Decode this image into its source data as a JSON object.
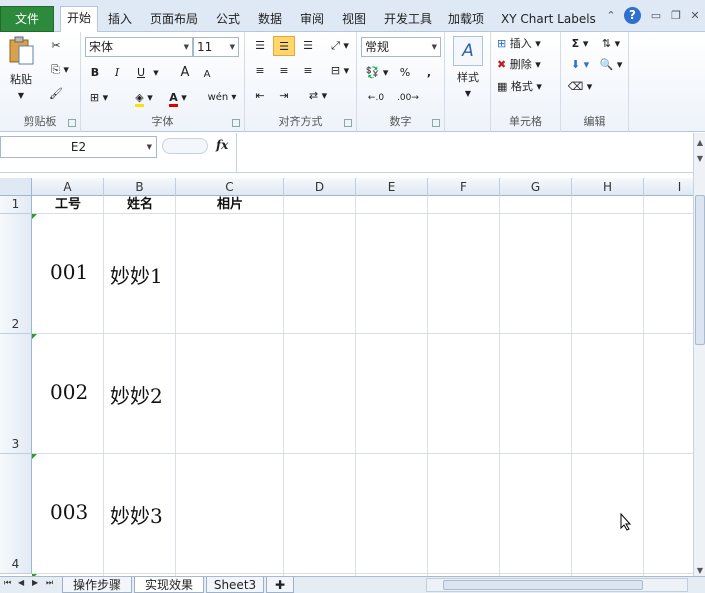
{
  "tabs": {
    "file": "文件",
    "items": [
      "开始",
      "插入",
      "页面布局",
      "公式",
      "数据",
      "审阅",
      "视图",
      "开发工具",
      "加载项",
      "XY Chart Labels"
    ],
    "active": "开始"
  },
  "ribbon": {
    "clipboard": {
      "label": "剪贴板",
      "paste": "粘贴"
    },
    "font": {
      "label": "字体",
      "name": "宋体",
      "size": "11",
      "bold": "B",
      "italic": "I",
      "underline": "U",
      "grow": "A",
      "shrink": "A",
      "phonetic": "wén"
    },
    "alignment": {
      "label": "对齐方式"
    },
    "number": {
      "label": "数字",
      "format": "常规",
      "percent": "%",
      "comma": ",",
      "inc_decimal": ".0",
      "dec_decimal": ".00"
    },
    "styles": {
      "label": "样式"
    },
    "cells": {
      "label": "单元格",
      "insert": "插入",
      "delete": "删除",
      "format": "格式"
    },
    "editing": {
      "label": "编辑",
      "sum": "Σ"
    }
  },
  "formula_bar": {
    "name_box": "E2",
    "fx": "fx",
    "value": ""
  },
  "grid": {
    "columns": [
      "A",
      "B",
      "C",
      "D",
      "E",
      "F",
      "G",
      "H",
      "I"
    ],
    "rows": [
      "1",
      "2",
      "3",
      "4"
    ],
    "header_cells": {
      "A1": "工号",
      "B1": "姓名",
      "C1": "相片"
    },
    "data": [
      {
        "id": "001",
        "name": "妙妙1"
      },
      {
        "id": "002",
        "name": "妙妙2"
      },
      {
        "id": "003",
        "name": "妙妙3"
      }
    ]
  },
  "sheets": [
    "操作步骤",
    "实现效果",
    "Sheet3"
  ],
  "active_sheet": "实现效果",
  "colors": {
    "file_tab": "#2d8a3c",
    "tab_bar": "#dfe9f5",
    "header_fill": "#dfe8f3",
    "gridline": "#dadfe6",
    "error_marker": "#2f9a2f"
  }
}
